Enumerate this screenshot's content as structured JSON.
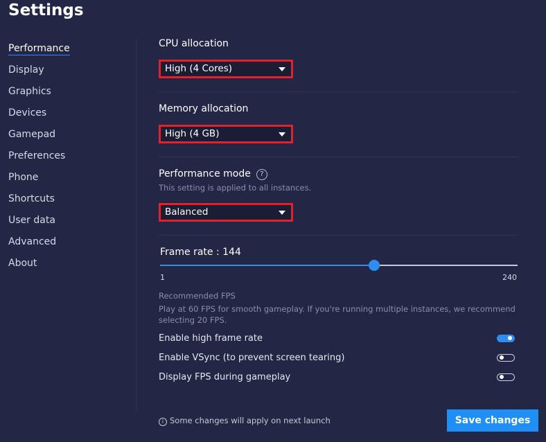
{
  "page": {
    "title": "Settings"
  },
  "sidebar": {
    "items": [
      {
        "label": "Performance",
        "active": true
      },
      {
        "label": "Display"
      },
      {
        "label": "Graphics"
      },
      {
        "label": "Devices"
      },
      {
        "label": "Gamepad"
      },
      {
        "label": "Preferences"
      },
      {
        "label": "Phone"
      },
      {
        "label": "Shortcuts"
      },
      {
        "label": "User data"
      },
      {
        "label": "Advanced"
      },
      {
        "label": "About"
      }
    ]
  },
  "cpu": {
    "label": "CPU allocation",
    "value": "High (4 Cores)"
  },
  "memory": {
    "label": "Memory allocation",
    "value": "High (4 GB)"
  },
  "performance_mode": {
    "label": "Performance mode",
    "help_icon": "question-circle-icon",
    "help_glyph": "?",
    "sublabel": "This setting is applied to all instances.",
    "value": "Balanced"
  },
  "frame_rate": {
    "label": "Frame rate : 144",
    "value": 144,
    "min": 1,
    "max": 240,
    "min_label": "1",
    "max_label": "240"
  },
  "recommended": {
    "title": "Recommended FPS",
    "text": "Play at 60 FPS for smooth gameplay. If you're running multiple instances, we recommend selecting 20 FPS."
  },
  "toggles": [
    {
      "label": "Enable high frame rate",
      "on": true
    },
    {
      "label": "Enable VSync (to prevent screen tearing)",
      "on": false
    },
    {
      "label": "Display FPS during gameplay",
      "on": false
    }
  ],
  "footer": {
    "note_icon": "info-circle-icon",
    "note_glyph": "i",
    "note": "Some changes will apply on next launch",
    "save_label": "Save changes"
  },
  "colors": {
    "background": "#232644",
    "accent": "#1f8ef5",
    "highlight_border": "#e3212b"
  }
}
